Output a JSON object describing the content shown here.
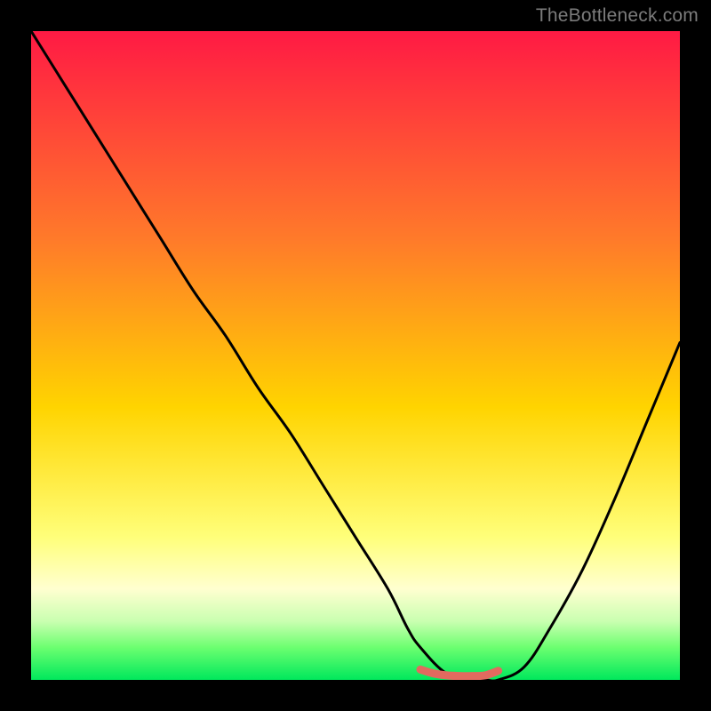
{
  "watermark": "TheBottleneck.com",
  "colors": {
    "top": "#ff1a44",
    "mid_upper": "#ff7a2a",
    "mid": "#ffd400",
    "mid_lower_light": "#ffff7a",
    "mid_lower_pale": "#ffffd0",
    "green_pale": "#c9ffb0",
    "green_mid": "#6cff70",
    "green": "#00e85c",
    "curve": "#000000",
    "segment": "#e26a5f"
  },
  "chart_data": {
    "type": "line",
    "title": "",
    "xlabel": "",
    "ylabel": "",
    "xlim": [
      0,
      100
    ],
    "ylim": [
      0,
      100
    ],
    "series": [
      {
        "name": "bottleneck-curve",
        "x": [
          0,
          5,
          10,
          15,
          20,
          25,
          30,
          35,
          40,
          45,
          50,
          55,
          58,
          60,
          64,
          68,
          70,
          72,
          76,
          80,
          85,
          90,
          95,
          100
        ],
        "y": [
          100,
          92,
          84,
          76,
          68,
          60,
          53,
          45,
          38,
          30,
          22,
          14,
          8,
          5,
          1,
          0,
          0,
          0,
          2,
          8,
          17,
          28,
          40,
          52
        ]
      },
      {
        "name": "optimal-segment",
        "x": [
          60,
          62,
          64,
          66,
          68,
          70,
          72
        ],
        "y": [
          1.6,
          1.0,
          0.7,
          0.6,
          0.6,
          0.7,
          1.4
        ]
      }
    ]
  }
}
